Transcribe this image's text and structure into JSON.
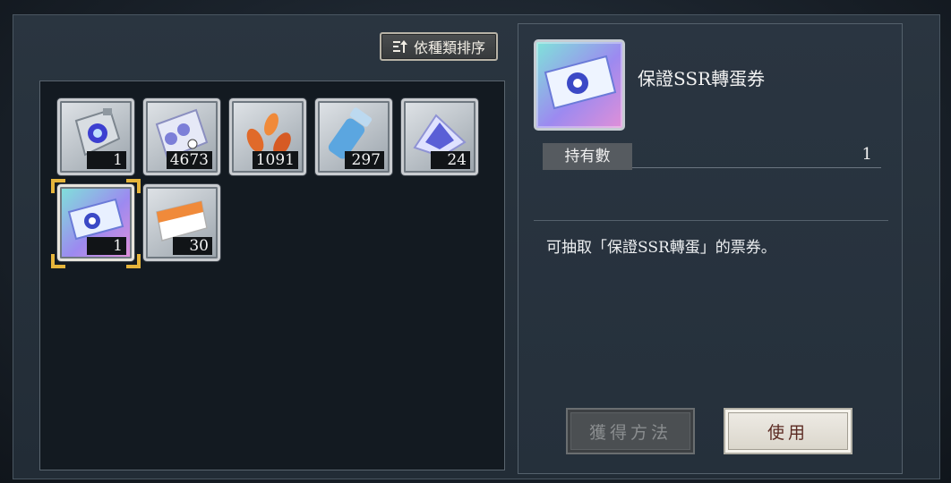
{
  "toolbar": {
    "sort_label": "依種類排序"
  },
  "inventory": {
    "items": [
      {
        "name": "crystal-bag",
        "count": "1"
      },
      {
        "name": "gear-plate",
        "count": "4673"
      },
      {
        "name": "orange-leaves",
        "count": "1091"
      },
      {
        "name": "battery-cylinder",
        "count": "297"
      },
      {
        "name": "crystal-pile",
        "count": "24"
      },
      {
        "name": "ssr-ticket",
        "count": "1",
        "selected": true
      },
      {
        "name": "gacha-point-card",
        "count": "30"
      }
    ]
  },
  "detail": {
    "title": "保證SSR轉蛋券",
    "owned_label": "持有數",
    "owned_value": "1",
    "description": "可抽取「保證SSR轉蛋」的票券。",
    "obtain_button": "獲得方法",
    "use_button": "使用"
  },
  "colors": {
    "selection": "#e6b53b",
    "use_text": "#5b2a22",
    "panel_bg": "#131a21"
  }
}
